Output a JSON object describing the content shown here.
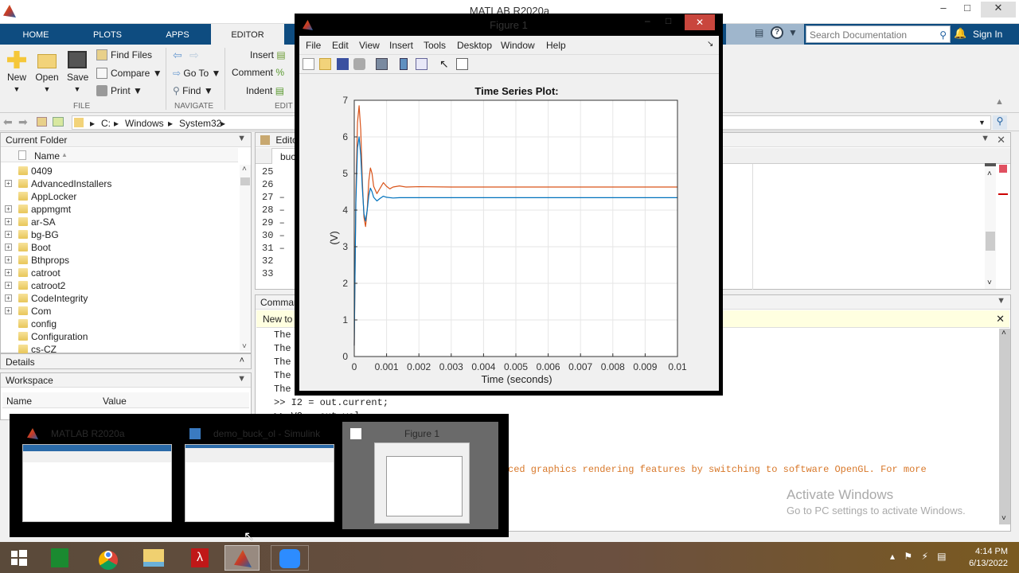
{
  "app": {
    "window_title": "MATLAB R2020a",
    "ribbon_tabs": [
      {
        "label": "HOME",
        "active": false
      },
      {
        "label": "PLOTS",
        "active": false
      },
      {
        "label": "APPS",
        "active": false
      },
      {
        "label": "EDITOR",
        "active": true
      }
    ],
    "search_placeholder": "Search Documentation",
    "sign_in": "Sign In",
    "ribbon": {
      "file": {
        "new": "New",
        "open": "Open",
        "save": "Save",
        "find_files": "Find Files",
        "compare": "Compare",
        "print": "Print",
        "group_label": "FILE"
      },
      "navigate": {
        "go_to": "Go To",
        "find": "Find",
        "group_label": "NAVIGATE"
      },
      "edit": {
        "insert": "Insert",
        "comment": "Comment",
        "indent": "Indent",
        "group_label": "EDIT"
      }
    },
    "address_path": [
      "C:",
      "Windows",
      "System32"
    ],
    "current_folder": {
      "title": "Current Folder",
      "column_name": "Name",
      "items": [
        {
          "name": "0409",
          "expandable": false
        },
        {
          "name": "AdvancedInstallers",
          "expandable": true
        },
        {
          "name": "AppLocker",
          "expandable": false
        },
        {
          "name": "appmgmt",
          "expandable": true
        },
        {
          "name": "ar-SA",
          "expandable": true
        },
        {
          "name": "bg-BG",
          "expandable": true
        },
        {
          "name": "Boot",
          "expandable": true
        },
        {
          "name": "Bthprops",
          "expandable": true
        },
        {
          "name": "catroot",
          "expandable": true
        },
        {
          "name": "catroot2",
          "expandable": true
        },
        {
          "name": "CodeIntegrity",
          "expandable": true
        },
        {
          "name": "Com",
          "expandable": true
        },
        {
          "name": "config",
          "expandable": false
        },
        {
          "name": "Configuration",
          "expandable": false
        },
        {
          "name": "cs-CZ",
          "expandable": false
        }
      ]
    },
    "details_title": "Details",
    "workspace": {
      "title": "Workspace",
      "col_name": "Name",
      "col_value": "Value"
    },
    "editor": {
      "title": "Editor",
      "tab": "buc",
      "line_numbers": [
        "25",
        "26",
        "27 –",
        "28 –",
        "29 –",
        "30 –",
        "31 –",
        "32",
        "33"
      ]
    },
    "command_window": {
      "title": "Comman",
      "banner": "New to",
      "lines": [
        "The",
        "The",
        "The",
        "The",
        "The",
        ">> I2 = out.current;",
        ">> V2 = out.vol"
      ],
      "warning": "ced graphics rendering features by switching to software OpenGL. For more"
    },
    "watermark": {
      "title": "Activate Windows",
      "subtitle": "Go to PC settings to activate Windows."
    }
  },
  "figure": {
    "title": "Figure 1",
    "menu": [
      "File",
      "Edit",
      "View",
      "Insert",
      "Tools",
      "Desktop",
      "Window",
      "Help"
    ]
  },
  "chart_data": {
    "type": "line",
    "title": "Time Series Plot:",
    "xlabel": "Time (seconds)",
    "ylabel": "(V)",
    "xlim": [
      0,
      0.01
    ],
    "ylim": [
      0,
      7
    ],
    "xticks": [
      "0",
      "0.001",
      "0.002",
      "0.003",
      "0.004",
      "0.005",
      "0.006",
      "0.007",
      "0.008",
      "0.009",
      "0.01"
    ],
    "yticks": [
      "0",
      "1",
      "2",
      "3",
      "4",
      "5",
      "6",
      "7"
    ],
    "grid": true,
    "series": [
      {
        "name": "series-orange",
        "color": "#d95319",
        "x": [
          0,
          2e-05,
          5e-05,
          0.0001,
          0.00015,
          0.0002,
          0.00025,
          0.0003,
          0.00035,
          0.0004,
          0.00045,
          0.0005,
          0.00055,
          0.0006,
          0.0007,
          0.0008,
          0.0009,
          0.001,
          0.0011,
          0.0012,
          0.0014,
          0.0016,
          0.002,
          0.003,
          0.005,
          0.01
        ],
        "y": [
          0.3,
          2.0,
          4.5,
          6.4,
          6.85,
          6.2,
          4.8,
          3.8,
          3.55,
          4.0,
          4.8,
          5.15,
          5.0,
          4.65,
          4.45,
          4.6,
          4.75,
          4.65,
          4.58,
          4.63,
          4.66,
          4.63,
          4.64,
          4.63,
          4.63,
          4.63
        ]
      },
      {
        "name": "series-blue",
        "color": "#0072bd",
        "x": [
          0,
          2e-05,
          5e-05,
          0.0001,
          0.00015,
          0.0002,
          0.00025,
          0.0003,
          0.00035,
          0.0004,
          0.00045,
          0.0005,
          0.00055,
          0.0006,
          0.0007,
          0.0008,
          0.0009,
          0.001,
          0.0012,
          0.0014,
          0.002,
          0.005,
          0.01
        ],
        "y": [
          0.3,
          2.0,
          4.2,
          5.7,
          6.0,
          5.5,
          4.6,
          3.9,
          3.7,
          4.0,
          4.4,
          4.6,
          4.5,
          4.35,
          4.25,
          4.32,
          4.38,
          4.35,
          4.33,
          4.34,
          4.34,
          4.34,
          4.34
        ]
      }
    ]
  },
  "switcher": {
    "items": [
      {
        "title": "MATLAB R2020a",
        "selected": false
      },
      {
        "title": "demo_buck_ol - Simulink",
        "selected": false
      },
      {
        "title": "Figure 1",
        "selected": true
      }
    ]
  },
  "taskbar": {
    "apps": [
      "start",
      "store",
      "chrome",
      "file-explorer",
      "acrobat",
      "matlab",
      "zoom"
    ],
    "time": "4:14 PM",
    "date": "6/13/2022"
  }
}
